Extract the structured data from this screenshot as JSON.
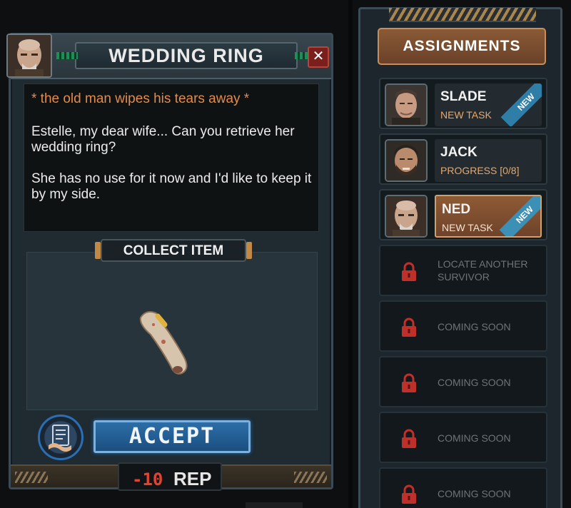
{
  "dialog": {
    "title": "WEDDING RING",
    "close_label": "✕",
    "speech_action": "* the old man wipes his tears away *",
    "speech_lines": [
      "Estelle, my dear wife... Can you retrieve her wedding ring?",
      "She has no use for it now and I'd like to keep it by my side."
    ],
    "collect_label": "COLLECT ITEM",
    "accept_label": "ACCEPT",
    "cost_value": "-10",
    "cost_unit": "REP"
  },
  "assignments": {
    "title": "ASSIGNMENTS",
    "rows": [
      {
        "name": "SLADE",
        "status": "NEW TASK",
        "badge": "NEW",
        "active": false
      },
      {
        "name": "JACK",
        "status": "PROGRESS [0/8]",
        "badge": "",
        "active": false
      },
      {
        "name": "NED",
        "status": "NEW TASK",
        "badge": "NEW",
        "active": true
      }
    ],
    "locked": [
      {
        "text": "LOCATE ANOTHER SURVIVOR"
      },
      {
        "text": "COMING SOON"
      },
      {
        "text": "COMING SOON"
      },
      {
        "text": "COMING SOON"
      },
      {
        "text": "COMING SOON"
      }
    ]
  },
  "colors": {
    "accent_orange": "#e48a4a",
    "accept_blue": "#2c6ea8",
    "rep_red": "#e2432f",
    "lock_red": "#c0302a"
  }
}
